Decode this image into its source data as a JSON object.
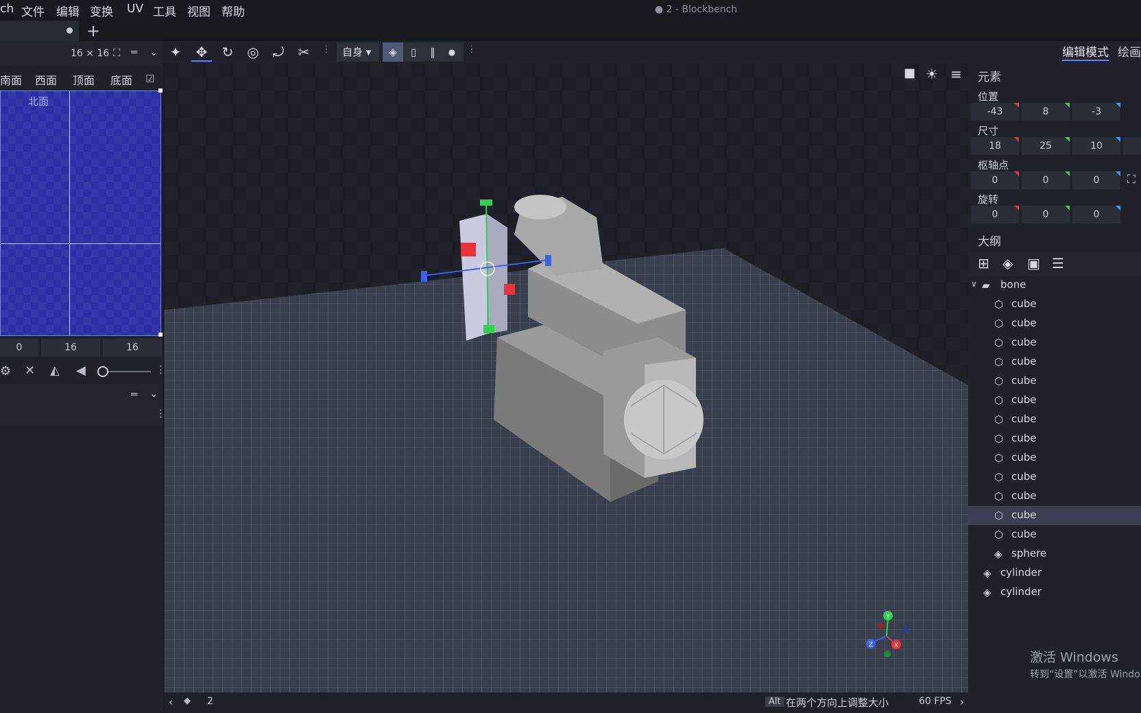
{
  "menu": {
    "app_fragment": "ch",
    "items": [
      "文件",
      "编辑",
      "变换",
      "UV",
      "工具",
      "视图",
      "帮助"
    ],
    "window_title": "● 2 - Blockbench"
  },
  "tabs": {
    "add_label": "+"
  },
  "uv_panel": {
    "size_label": "16 × 16",
    "face_tabs": [
      "南面",
      "西面",
      "顶面",
      "底面"
    ],
    "face_label": "北面",
    "inputs": [
      "0",
      "16",
      "16"
    ]
  },
  "toolbar": {
    "space_select": "自身",
    "mode_edit": "编辑模式",
    "mode_paint": "绘画"
  },
  "element_panel": {
    "title": "元素",
    "position_label": "位置",
    "position": [
      "-43",
      "8",
      "-3"
    ],
    "size_label": "尺寸",
    "size": [
      "18",
      "25",
      "10"
    ],
    "pivot_label": "枢轴点",
    "pivot": [
      "0",
      "0",
      "0"
    ],
    "rotation_label": "旋转",
    "rotation": [
      "0",
      "0",
      "0"
    ]
  },
  "outliner": {
    "title": "大纲",
    "group": "bone",
    "children": [
      "cube",
      "cube",
      "cube",
      "cube",
      "cube",
      "cube",
      "cube",
      "cube",
      "cube",
      "cube",
      "cube",
      "cube",
      "cube",
      "sphere"
    ],
    "selected_index": 11,
    "root_items": [
      "cylinder",
      "cylinder"
    ]
  },
  "viewport": {
    "axis_labels": {
      "y": "Y",
      "z": "Z",
      "x": "X"
    }
  },
  "status": {
    "frame": "2",
    "alt_key": "Alt",
    "hint": "在两个方向上调整大小",
    "fps": "60 FPS"
  },
  "watermark": {
    "title": "激活 Windows",
    "subtitle": "转到“设置”以激活 Windo"
  },
  "colors": {
    "accent": "#6d7aff",
    "axis_x": "#e8343a",
    "axis_y": "#2fd24a",
    "axis_z": "#3a62e8"
  }
}
